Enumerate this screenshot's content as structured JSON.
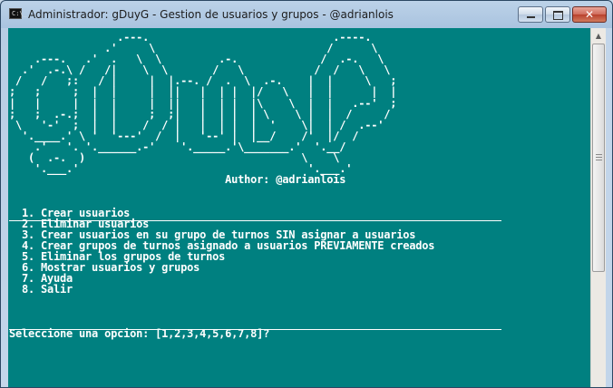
{
  "window": {
    "title": "Administrador:  gDuyG - Gestion de usuarios y grupos - @adrianlois",
    "icon_label": "C:\\_",
    "close_label": "✕"
  },
  "console": {
    "banner": "                 .---.                             .----.\n               .'     \\                           /      \\\n    .---.   .'  .   \\  \\         .-.             /  .-.   \\\n  .'  .-.\\ /   /|    \\  \\       /   \\           /  /   \\   \\\n /   /   ;:   / |     |  |.--. /  .  \\  .-.    |  |     \\   ;\n;   ;     ;  |  |     |  ||   |  | |  |/   \\   |  |      |  |\n|   |     |  |  |     |  ||   |  | |  |\\    \\  |  |   .--'  ;\n;   ;  .-.;  |  |     ;  ;|   |  | |  | \\    \\ |  |  /     /\n \\   '-'  ;  |  |    /  / |   |  | |  |  '    \\|  | /  .--'\n  '.____.' \\ '  '---'  /  |   '--' |  |__/    /'  |/  /\n    .'   '. '.______.-'    '._____.'\\_______.'  '.__/\n   (  .-.  )                                  \\    \\\n    '.___.'                                    '.___.'",
    "author_line": "                                  Author: @adrianlois",
    "menu": [
      "  1. Crear usuarios",
      "  2. Eliminar usuarios",
      "  3. Crear usuarios en su grupo de turnos SIN asignar a usuarios",
      "  4. Crear grupos de turnos asignado a usuarios PREVIAMENTE creados",
      "  5. Eliminar los grupos de turnos",
      "  6. Mostrar usuarios y grupos",
      "  7. Ayuda",
      "  8. Salir"
    ],
    "prompt": "Seleccione una opcion: [1,2,3,4,5,6,7,8]?"
  },
  "colors": {
    "console_bg": "#008080",
    "console_fg": "#ffffff"
  }
}
